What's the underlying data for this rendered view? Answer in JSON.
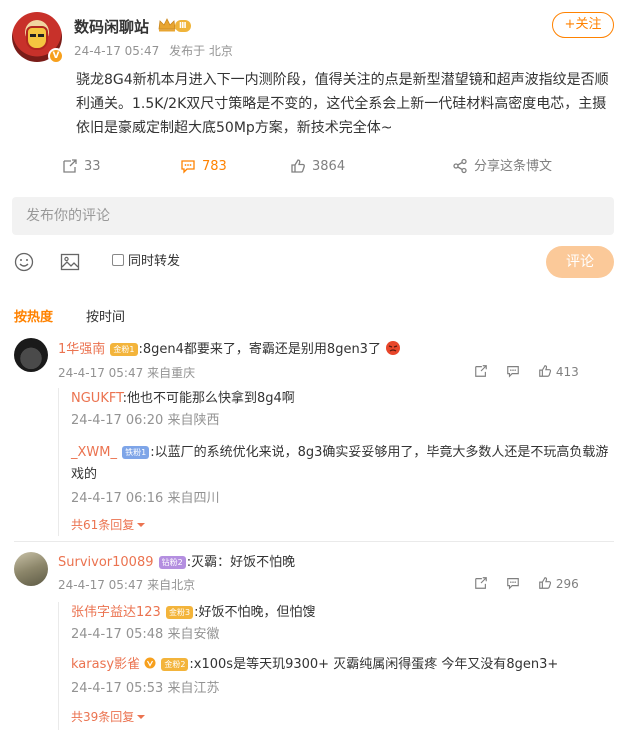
{
  "post": {
    "author": "数码闲聊站",
    "level": "Ⅲ",
    "time": "24-4-17 05:47",
    "location": "发布于 北京",
    "follow_label": "+关注",
    "text": "骁龙8G4新机本月进入下一内测阶段，值得关注的点是新型潜望镜和超声波指纹是否顺利通关。1.5K/2K双尺寸策略是不变的，这代全系会上新一代硅材料高密度电芯，主摄依旧是豪威定制超大底50Mp方案，新技术完全体~",
    "reposts": "33",
    "comments": "783",
    "likes": "3864",
    "share_label": "分享这条博文"
  },
  "composer": {
    "placeholder": "发布你的评论",
    "repost_label": "同时转发",
    "submit_label": "评论"
  },
  "sort": {
    "hot": "按热度",
    "time": "按时间"
  },
  "comments": [
    {
      "user": "1华强南",
      "badge": "金粉1",
      "text": ":8gen4都要来了，寄霸还是别用8gen3了",
      "time": "24-4-17 05:47",
      "location": "来自重庆",
      "likes": "413",
      "replies": [
        {
          "user": "NGUKFT",
          "text": ":他也不可能那么快拿到8g4啊",
          "time": "24-4-17 06:20",
          "location": "来自陕西"
        },
        {
          "user": "_XWM_",
          "badge": "铁粉1",
          "text": ":以蓝厂的系统优化来说，8g3确实妥妥够用了，毕竟大多数人还是不玩高负载游",
          "text2": "戏的",
          "time": "24-4-17 06:16",
          "location": "来自四川"
        }
      ],
      "more": "共61条回复"
    },
    {
      "user": "Survivor10089",
      "badge": "钻粉2",
      "text": ":灭霸：好饭不怕晚",
      "time": "24-4-17 05:47",
      "location": "来自北京",
      "likes": "296",
      "replies": [
        {
          "user": "张伟字益达123",
          "badge": "金粉3",
          "text": ":好饭不怕晚，但怕馊",
          "time": "24-4-17 05:48",
          "location": "来自安徽"
        },
        {
          "user": "karasy影雀",
          "badge": "金粉2",
          "text": ":x100s是等天玑9300+    灭霸纯属闲得蛋疼 今年又没有8gen3+",
          "time": "24-4-17 05:53",
          "location": "来自江苏"
        }
      ],
      "more": "共39条回复"
    }
  ],
  "colors": {
    "accent": "#ff8200",
    "username": "#eb7350",
    "meta": "#939393"
  }
}
